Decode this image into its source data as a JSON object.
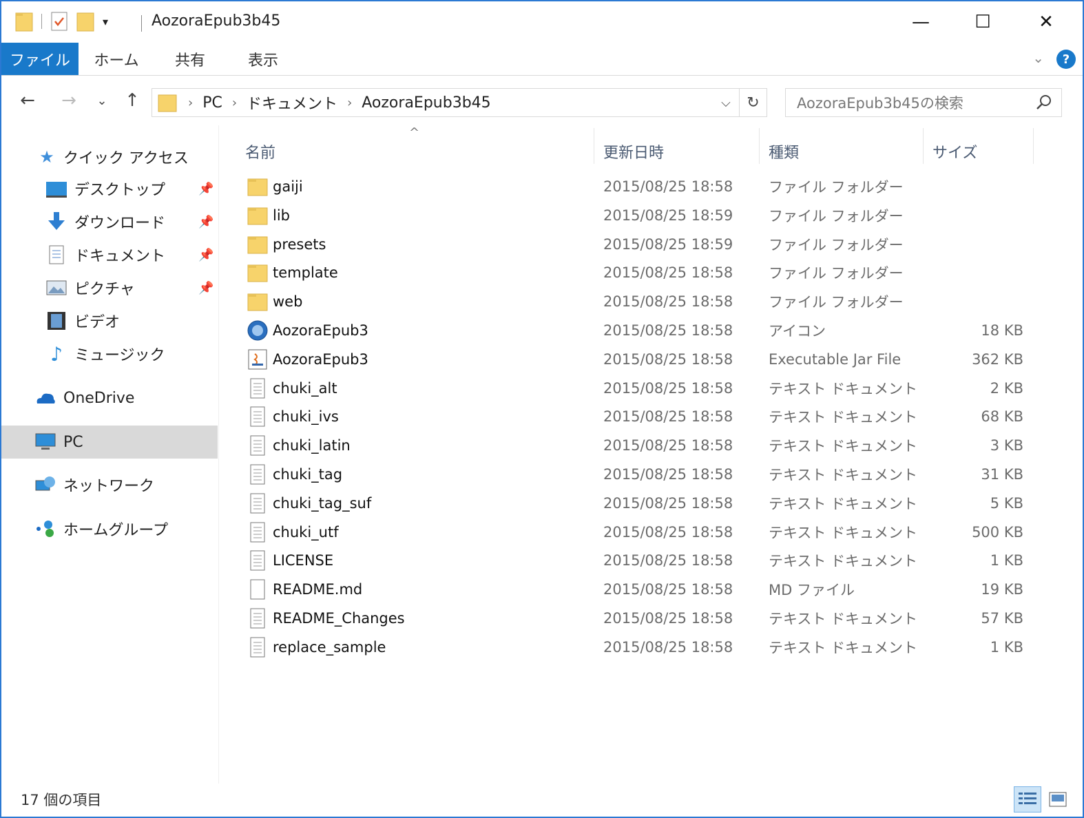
{
  "window": {
    "title": "AozoraEpub3b45",
    "minimize": "—",
    "maximize": "☐",
    "close": "✕"
  },
  "ribbon": {
    "tabs": [
      {
        "label": "ファイル",
        "active": true
      },
      {
        "label": "ホーム",
        "active": false
      },
      {
        "label": "共有",
        "active": false
      },
      {
        "label": "表示",
        "active": false
      }
    ],
    "help": "?",
    "collapse": "⌄"
  },
  "nav": {
    "back": "←",
    "forward": "→",
    "recent": "⌄",
    "up": "↑",
    "breadcrumb": [
      "PC",
      "ドキュメント",
      "AozoraEpub3b45"
    ],
    "search_placeholder": "AozoraEpub3b45の検索"
  },
  "sidebar": {
    "quick_access": "クイック アクセス",
    "items": [
      {
        "label": "デスクトップ",
        "icon": "desktop-icon",
        "pinned": true
      },
      {
        "label": "ダウンロード",
        "icon": "download-icon",
        "pinned": true
      },
      {
        "label": "ドキュメント",
        "icon": "document-icon",
        "pinned": true
      },
      {
        "label": "ピクチャ",
        "icon": "picture-icon",
        "pinned": true
      },
      {
        "label": "ビデオ",
        "icon": "video-icon",
        "pinned": false
      },
      {
        "label": "ミュージック",
        "icon": "music-icon",
        "pinned": false
      }
    ],
    "onedrive": "OneDrive",
    "pc": "PC",
    "network": "ネットワーク",
    "homegroup": "ホームグループ"
  },
  "columns": {
    "name": "名前",
    "date": "更新日時",
    "type": "種類",
    "size": "サイズ",
    "sort_arrow": "^"
  },
  "files": [
    {
      "name": "gaiji",
      "date": "2015/08/25 18:58",
      "type": "ファイル フォルダー",
      "size": "",
      "icon": "folder-icon"
    },
    {
      "name": "lib",
      "date": "2015/08/25 18:59",
      "type": "ファイル フォルダー",
      "size": "",
      "icon": "folder-icon"
    },
    {
      "name": "presets",
      "date": "2015/08/25 18:59",
      "type": "ファイル フォルダー",
      "size": "",
      "icon": "folder-icon"
    },
    {
      "name": "template",
      "date": "2015/08/25 18:58",
      "type": "ファイル フォルダー",
      "size": "",
      "icon": "folder-icon"
    },
    {
      "name": "web",
      "date": "2015/08/25 18:58",
      "type": "ファイル フォルダー",
      "size": "",
      "icon": "folder-icon"
    },
    {
      "name": "AozoraEpub3",
      "date": "2015/08/25 18:58",
      "type": "アイコン",
      "size": "18 KB",
      "icon": "app-icon"
    },
    {
      "name": "AozoraEpub3",
      "date": "2015/08/25 18:58",
      "type": "Executable Jar File",
      "size": "362 KB",
      "icon": "java-icon"
    },
    {
      "name": "chuki_alt",
      "date": "2015/08/25 18:58",
      "type": "テキスト ドキュメント",
      "size": "2 KB",
      "icon": "text-file-icon"
    },
    {
      "name": "chuki_ivs",
      "date": "2015/08/25 18:58",
      "type": "テキスト ドキュメント",
      "size": "68 KB",
      "icon": "text-file-icon"
    },
    {
      "name": "chuki_latin",
      "date": "2015/08/25 18:58",
      "type": "テキスト ドキュメント",
      "size": "3 KB",
      "icon": "text-file-icon"
    },
    {
      "name": "chuki_tag",
      "date": "2015/08/25 18:58",
      "type": "テキスト ドキュメント",
      "size": "31 KB",
      "icon": "text-file-icon"
    },
    {
      "name": "chuki_tag_suf",
      "date": "2015/08/25 18:58",
      "type": "テキスト ドキュメント",
      "size": "5 KB",
      "icon": "text-file-icon"
    },
    {
      "name": "chuki_utf",
      "date": "2015/08/25 18:58",
      "type": "テキスト ドキュメント",
      "size": "500 KB",
      "icon": "text-file-icon"
    },
    {
      "name": "LICENSE",
      "date": "2015/08/25 18:58",
      "type": "テキスト ドキュメント",
      "size": "1 KB",
      "icon": "text-file-icon"
    },
    {
      "name": "README.md",
      "date": "2015/08/25 18:58",
      "type": "MD ファイル",
      "size": "19 KB",
      "icon": "blank-file-icon"
    },
    {
      "name": "README_Changes",
      "date": "2015/08/25 18:58",
      "type": "テキスト ドキュメント",
      "size": "57 KB",
      "icon": "text-file-icon"
    },
    {
      "name": "replace_sample",
      "date": "2015/08/25 18:58",
      "type": "テキスト ドキュメント",
      "size": "1 KB",
      "icon": "text-file-icon"
    }
  ],
  "status": {
    "count_text": "17 個の項目"
  },
  "colors": {
    "accent": "#1979ca",
    "folder": "#f7d36b",
    "selected": "#d9d9d9"
  }
}
